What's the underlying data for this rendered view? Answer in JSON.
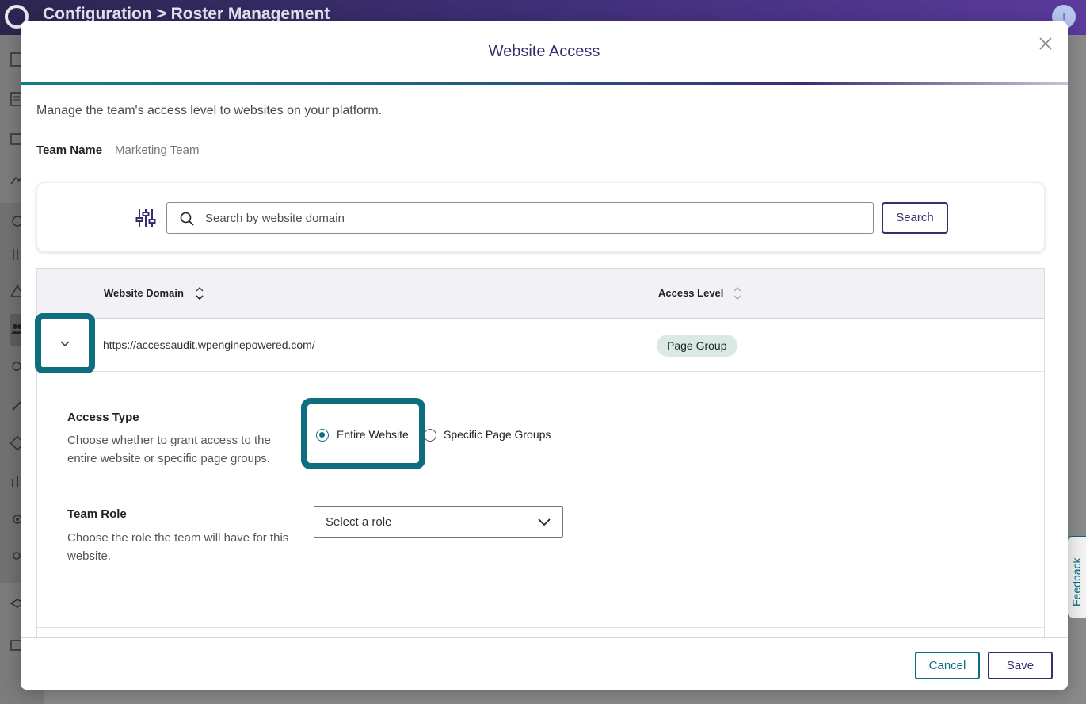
{
  "app": {
    "breadcrumb": "Configuration > Roster Management",
    "avatar_initial": "I",
    "feedback_label": "Feedback"
  },
  "modal": {
    "title": "Website Access",
    "description": "Manage the team's access level to websites on your platform.",
    "team_name_label": "Team Name",
    "team_name_value": "Marketing Team",
    "search": {
      "placeholder": "Search by website domain",
      "button_label": "Search"
    },
    "table": {
      "columns": [
        "Website Domain",
        "Access Level"
      ],
      "rows": [
        {
          "domain": "https://accessaudit.wpenginepowered.com/",
          "access_level": "Page Group"
        }
      ]
    },
    "expanded": {
      "access_type_title": "Access Type",
      "access_type_desc": "Choose whether to grant access to the entire website or specific page groups.",
      "options": [
        "Entire Website",
        "Specific Page Groups"
      ],
      "selected_option": "Entire Website",
      "team_role_title": "Team Role",
      "team_role_desc": "Choose the role the team will have for this website.",
      "role_select_placeholder": "Select a role"
    },
    "footer": {
      "cancel_label": "Cancel",
      "save_label": "Save"
    }
  },
  "colors": {
    "accent_teal": "#0e6e80",
    "accent_purple": "#3a2a6e",
    "badge_bg": "#dbe9e4"
  }
}
